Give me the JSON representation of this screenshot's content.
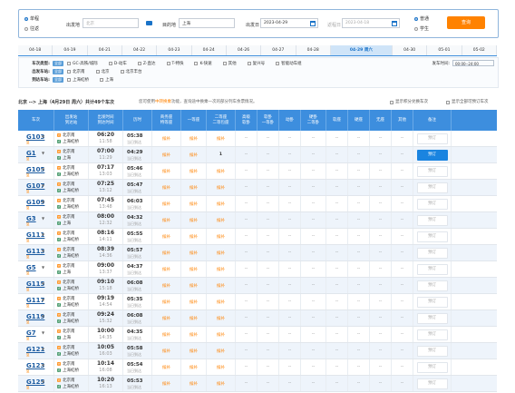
{
  "search": {
    "trip_type": [
      {
        "label": "单程",
        "checked": true
      },
      {
        "label": "往返",
        "checked": false
      }
    ],
    "from_label": "出发地",
    "from_value": "北京",
    "to_label": "目的地",
    "to_value": "上海",
    "depart_label": "出发日",
    "depart_value": "2023-04-29",
    "return_label": "返程日",
    "return_value": "2023-04-18",
    "passenger_type": [
      {
        "label": "普通",
        "checked": true
      },
      {
        "label": "学生",
        "checked": false
      }
    ],
    "query_label": "查询"
  },
  "tabs": [
    "04-18",
    "04-19",
    "04-21",
    "04-22",
    "04-23",
    "04-24",
    "04-26",
    "04-27",
    "04-28",
    "04-29 周六",
    "04-30",
    "05-01",
    "05-02"
  ],
  "active_tab": 9,
  "filters": {
    "all_label": "全部",
    "types_title": "车次类型:",
    "types": [
      "GC-高铁/城际",
      "D-动车",
      "Z-直达",
      "T-特快",
      "K-快速",
      "其他",
      "复兴号",
      "智能动车组"
    ],
    "from_title": "出发车站:",
    "from_stations": [
      "北京南",
      "北京",
      "北京丰台"
    ],
    "to_title": "到达车站:",
    "to_stations": [
      "上海虹桥",
      "上海"
    ],
    "time_label": "发车时间:",
    "time_value": "00:00--24:00"
  },
  "summary": {
    "route": "北京 --> 上海（4月29日 周六）共计49个车次",
    "tip_pre": "您可使用",
    "tip_hl": "中转换乘",
    "tip_post": "功能，查询途中换乘一次的部分列车余票情况。",
    "opt1": "显示积分兑换车次",
    "opt2": "显示全部可预订车次"
  },
  "columns": [
    "车次",
    "出发站\n到达站",
    "出发时间\n到达时间",
    "历时",
    "商务座\n特等座",
    "一等座",
    "二等座\n二等包座",
    "高级\n软卧",
    "软卧\n一等卧",
    "动卧",
    "硬卧\n二等卧",
    "软座",
    "硬座",
    "无座",
    "其他",
    "备注"
  ],
  "rows": [
    {
      "train": "G103",
      "tag": "复",
      "from": "北京南",
      "to": "上海虹桥",
      "dep": "06:20",
      "arr": "11:58",
      "dur": "05:38",
      "day": "当日到达",
      "biz": "候补",
      "first": "候补",
      "second": "候补",
      "book": "预订",
      "book_active": false
    },
    {
      "train": "G1",
      "tag": "复",
      "from": "北京南",
      "to": "上海",
      "dep": "07:00",
      "arr": "11:29",
      "dur": "04:29",
      "day": "当日到达",
      "biz": "候补",
      "first": "候补",
      "second": "1",
      "book": "预订",
      "book_active": true
    },
    {
      "train": "G105",
      "tag": "复",
      "from": "北京南",
      "to": "上海虹桥",
      "dep": "07:17",
      "arr": "13:03",
      "dur": "05:46",
      "day": "当日到达",
      "biz": "候补",
      "first": "候补",
      "second": "候补",
      "book": "预订",
      "book_active": false
    },
    {
      "train": "G107",
      "tag": "复",
      "from": "北京南",
      "to": "上海虹桥",
      "dep": "07:25",
      "arr": "13:12",
      "dur": "05:47",
      "day": "当日到达",
      "biz": "候补",
      "first": "候补",
      "second": "候补",
      "book": "预订",
      "book_active": false
    },
    {
      "train": "G109",
      "tag": "复",
      "from": "北京南",
      "to": "上海虹桥",
      "dep": "07:45",
      "arr": "13:48",
      "dur": "06:03",
      "day": "当日到达",
      "biz": "候补",
      "first": "候补",
      "second": "候补",
      "book": "预订",
      "book_active": false
    },
    {
      "train": "G3",
      "tag": "复",
      "from": "北京南",
      "to": "上海",
      "dep": "08:00",
      "arr": "12:32",
      "dur": "04:32",
      "day": "当日到达",
      "biz": "候补",
      "first": "候补",
      "second": "候补",
      "book": "预订",
      "book_active": false
    },
    {
      "train": "G111",
      "tag": "复",
      "from": "北京南",
      "to": "上海虹桥",
      "dep": "08:16",
      "arr": "14:11",
      "dur": "05:55",
      "day": "当日到达",
      "biz": "候补",
      "first": "候补",
      "second": "候补",
      "book": "预订",
      "book_active": false
    },
    {
      "train": "G113",
      "tag": "复",
      "from": "北京南",
      "to": "上海虹桥",
      "dep": "08:39",
      "arr": "14:36",
      "dur": "05:57",
      "day": "当日到达",
      "biz": "候补",
      "first": "候补",
      "second": "候补",
      "book": "预订",
      "book_active": false
    },
    {
      "train": "G5",
      "tag": "复",
      "from": "北京南",
      "to": "上海",
      "dep": "09:00",
      "arr": "13:37",
      "dur": "04:37",
      "day": "当日到达",
      "biz": "候补",
      "first": "候补",
      "second": "候补",
      "book": "预订",
      "book_active": false
    },
    {
      "train": "G115",
      "tag": "复",
      "from": "北京南",
      "to": "上海虹桥",
      "dep": "09:10",
      "arr": "15:18",
      "dur": "06:08",
      "day": "当日到达",
      "biz": "候补",
      "first": "候补",
      "second": "候补",
      "book": "预订",
      "book_active": false
    },
    {
      "train": "G117",
      "tag": "复",
      "from": "北京南",
      "to": "上海虹桥",
      "dep": "09:19",
      "arr": "14:54",
      "dur": "05:35",
      "day": "当日到达",
      "biz": "候补",
      "first": "候补",
      "second": "候补",
      "book": "预订",
      "book_active": false
    },
    {
      "train": "G119",
      "tag": "复",
      "from": "北京南",
      "to": "上海虹桥",
      "dep": "09:24",
      "arr": "15:32",
      "dur": "06:08",
      "day": "当日到达",
      "biz": "候补",
      "first": "候补",
      "second": "候补",
      "book": "预订",
      "book_active": false
    },
    {
      "train": "G7",
      "tag": "复",
      "from": "北京南",
      "to": "上海",
      "dep": "10:00",
      "arr": "14:35",
      "dur": "04:35",
      "day": "当日到达",
      "biz": "候补",
      "first": "候补",
      "second": "候补",
      "book": "预订",
      "book_active": false
    },
    {
      "train": "G121",
      "tag": "复",
      "from": "北京南",
      "to": "上海虹桥",
      "dep": "10:05",
      "arr": "16:03",
      "dur": "05:58",
      "day": "当日到达",
      "biz": "候补",
      "first": "候补",
      "second": "候补",
      "book": "预订",
      "book_active": false
    },
    {
      "train": "G123",
      "tag": "复",
      "from": "北京南",
      "to": "上海虹桥",
      "dep": "10:14",
      "arr": "16:08",
      "dur": "05:54",
      "day": "当日到达",
      "biz": "候补",
      "first": "候补",
      "second": "候补",
      "book": "预订",
      "book_active": false
    },
    {
      "train": "G125",
      "tag": "复",
      "from": "北京南",
      "to": "上海虹桥",
      "dep": "10:20",
      "arr": "16:13",
      "dur": "05:53",
      "day": "当日到达",
      "biz": "候补",
      "first": "候补",
      "second": "候补",
      "book": "预订",
      "book_active": false
    }
  ],
  "empty_cell": "--"
}
